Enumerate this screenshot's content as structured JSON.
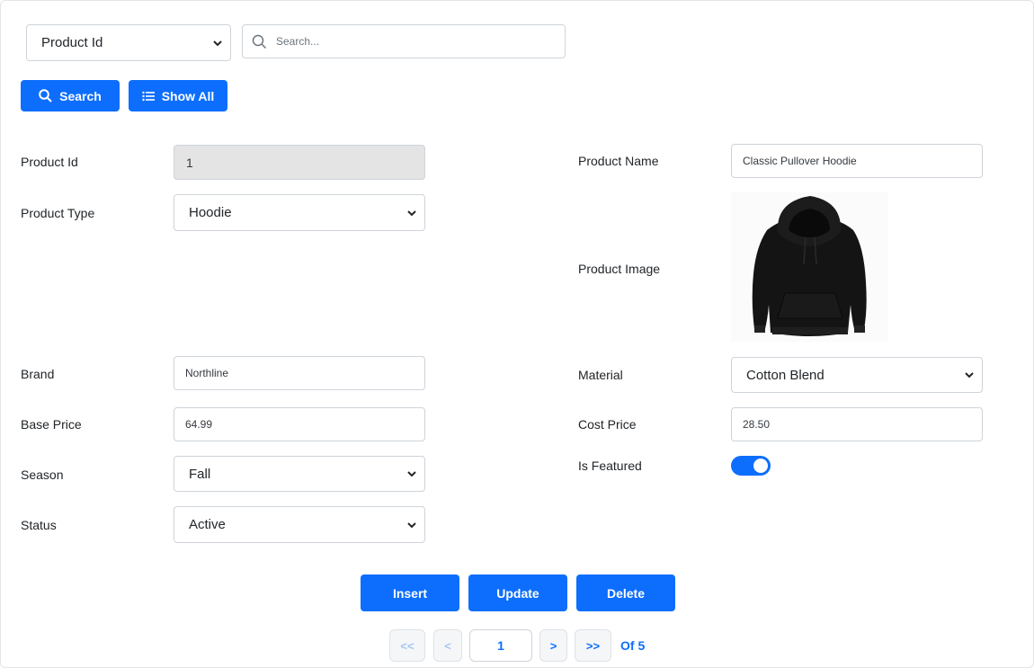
{
  "search": {
    "field_select": "Product Id",
    "placeholder": "Search...",
    "search_button": "Search",
    "show_all_button": "Show All"
  },
  "form": {
    "product_id": {
      "label": "Product Id",
      "value": "1"
    },
    "product_name": {
      "label": "Product Name",
      "value": "Classic Pullover Hoodie"
    },
    "product_type": {
      "label": "Product Type",
      "value": "Hoodie"
    },
    "product_image": {
      "label": "Product Image"
    },
    "brand": {
      "label": "Brand",
      "value": "Northline"
    },
    "material": {
      "label": "Material",
      "value": "Cotton Blend"
    },
    "base_price": {
      "label": "Base Price",
      "value": "64.99"
    },
    "cost_price": {
      "label": "Cost Price",
      "value": "28.50"
    },
    "season": {
      "label": "Season",
      "value": "Fall"
    },
    "is_featured": {
      "label": "Is Featured",
      "checked": true
    },
    "status": {
      "label": "Status",
      "value": "Active"
    }
  },
  "actions": {
    "insert": "Insert",
    "update": "Update",
    "delete": "Delete"
  },
  "pagination": {
    "first": "<<",
    "prev": "<",
    "current_page": "1",
    "next": ">",
    "last": ">>",
    "of_label": "Of 5"
  },
  "colors": {
    "primary": "#0d6efd",
    "readonly_bg": "#e4e4e4",
    "border": "#ced4da"
  }
}
